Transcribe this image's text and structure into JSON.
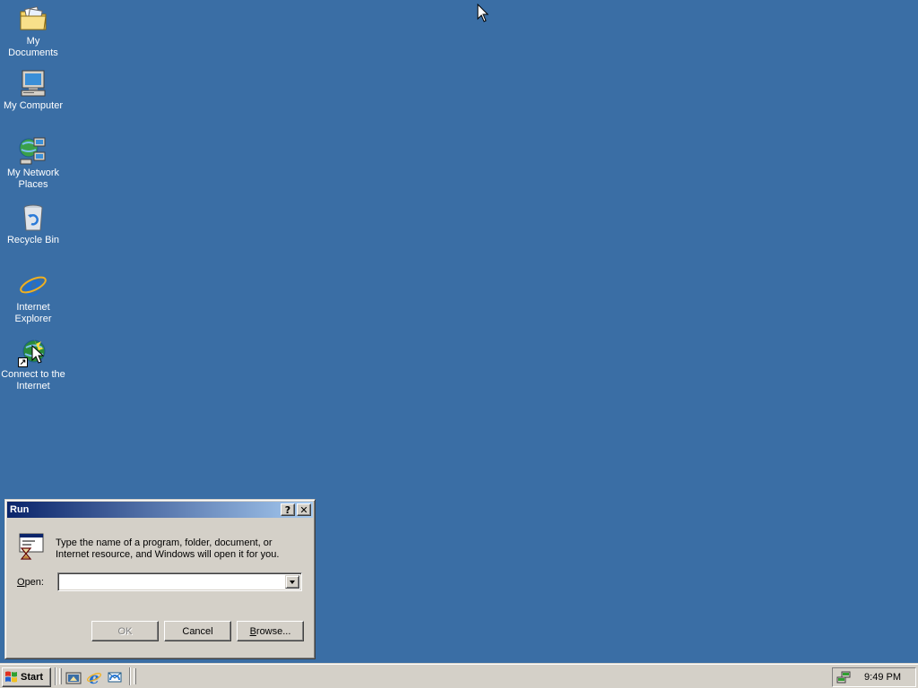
{
  "desktop": {
    "background_color": "#3a6ea5",
    "icons": [
      {
        "label": "My Documents",
        "icon": "folder-documents-icon"
      },
      {
        "label": "My Computer",
        "icon": "computer-icon"
      },
      {
        "label": "My Network Places",
        "icon": "network-places-icon"
      },
      {
        "label": "Recycle Bin",
        "icon": "recycle-bin-icon"
      },
      {
        "label": "Internet Explorer",
        "icon": "internet-explorer-icon"
      },
      {
        "label": "Connect to the Internet",
        "icon": "connect-internet-icon"
      }
    ]
  },
  "run_dialog": {
    "title": "Run",
    "help_button": "?",
    "close_button": "✕",
    "description": "Type the name of a program, folder, document, or Internet resource, and Windows will open it for you.",
    "open_label_mnemonic": "O",
    "open_label_rest": "pen:",
    "open_value": "",
    "ok_label": "OK",
    "cancel_label": "Cancel",
    "browse_label_mnemonic": "B",
    "browse_label_rest": "rowse...",
    "icon": "run-program-icon"
  },
  "taskbar": {
    "start_label": "Start",
    "quick_launch": [
      "show-desktop-icon",
      "internet-explorer-icon",
      "outlook-express-icon"
    ],
    "tray_icon": "network-connection-icon",
    "clock": "9:49 PM"
  },
  "colors": {
    "titlebar_start": "#0a246a",
    "titlebar_end": "#a6caf0",
    "face": "#d4d0c8"
  }
}
